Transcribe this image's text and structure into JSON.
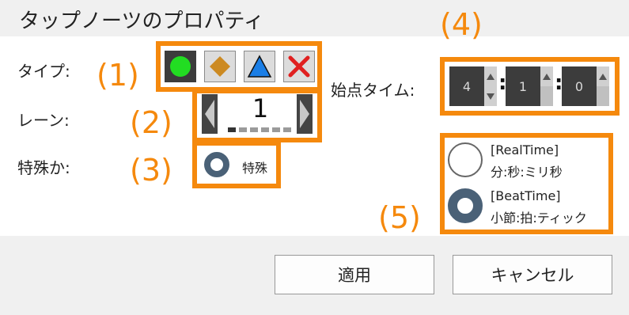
{
  "dialog": {
    "title": "タップノーツのプロパティ"
  },
  "fields": {
    "type_label": "タイプ:",
    "lane_label": "レーン:",
    "special_label": "特殊か:",
    "start_time_label": "始点タイム:"
  },
  "callouts": [
    "(1)",
    "(2)",
    "(3)",
    "(4)",
    "(5)"
  ],
  "note_types": [
    {
      "icon": "green-circle-icon",
      "color": "#22dd22",
      "selected": true
    },
    {
      "icon": "orange-diamond-icon",
      "color": "#cc8a22",
      "selected": false
    },
    {
      "icon": "blue-triangle-icon",
      "color": "#1a7ee6",
      "selected": false
    },
    {
      "icon": "red-x-icon",
      "color": "#e02020",
      "selected": false
    }
  ],
  "lane": {
    "value": "1",
    "indicator_count": 6,
    "active_index": 0
  },
  "special": {
    "label": "特殊",
    "checked": true
  },
  "start_time": {
    "measure": "4",
    "beat": "1",
    "tick": "0"
  },
  "time_mode": {
    "options": [
      {
        "title": "[RealTime]",
        "subtitle": "分:秒:ミリ秒",
        "selected": false
      },
      {
        "title": "[BeatTime]",
        "subtitle": "小節:拍:ティック",
        "selected": true
      }
    ]
  },
  "buttons": {
    "apply": "適用",
    "cancel": "キャンセル"
  },
  "colors": {
    "accent_orange": "#f5890d",
    "selected_bg": "#3c3c3c",
    "radio_ring": "#4a6177"
  }
}
